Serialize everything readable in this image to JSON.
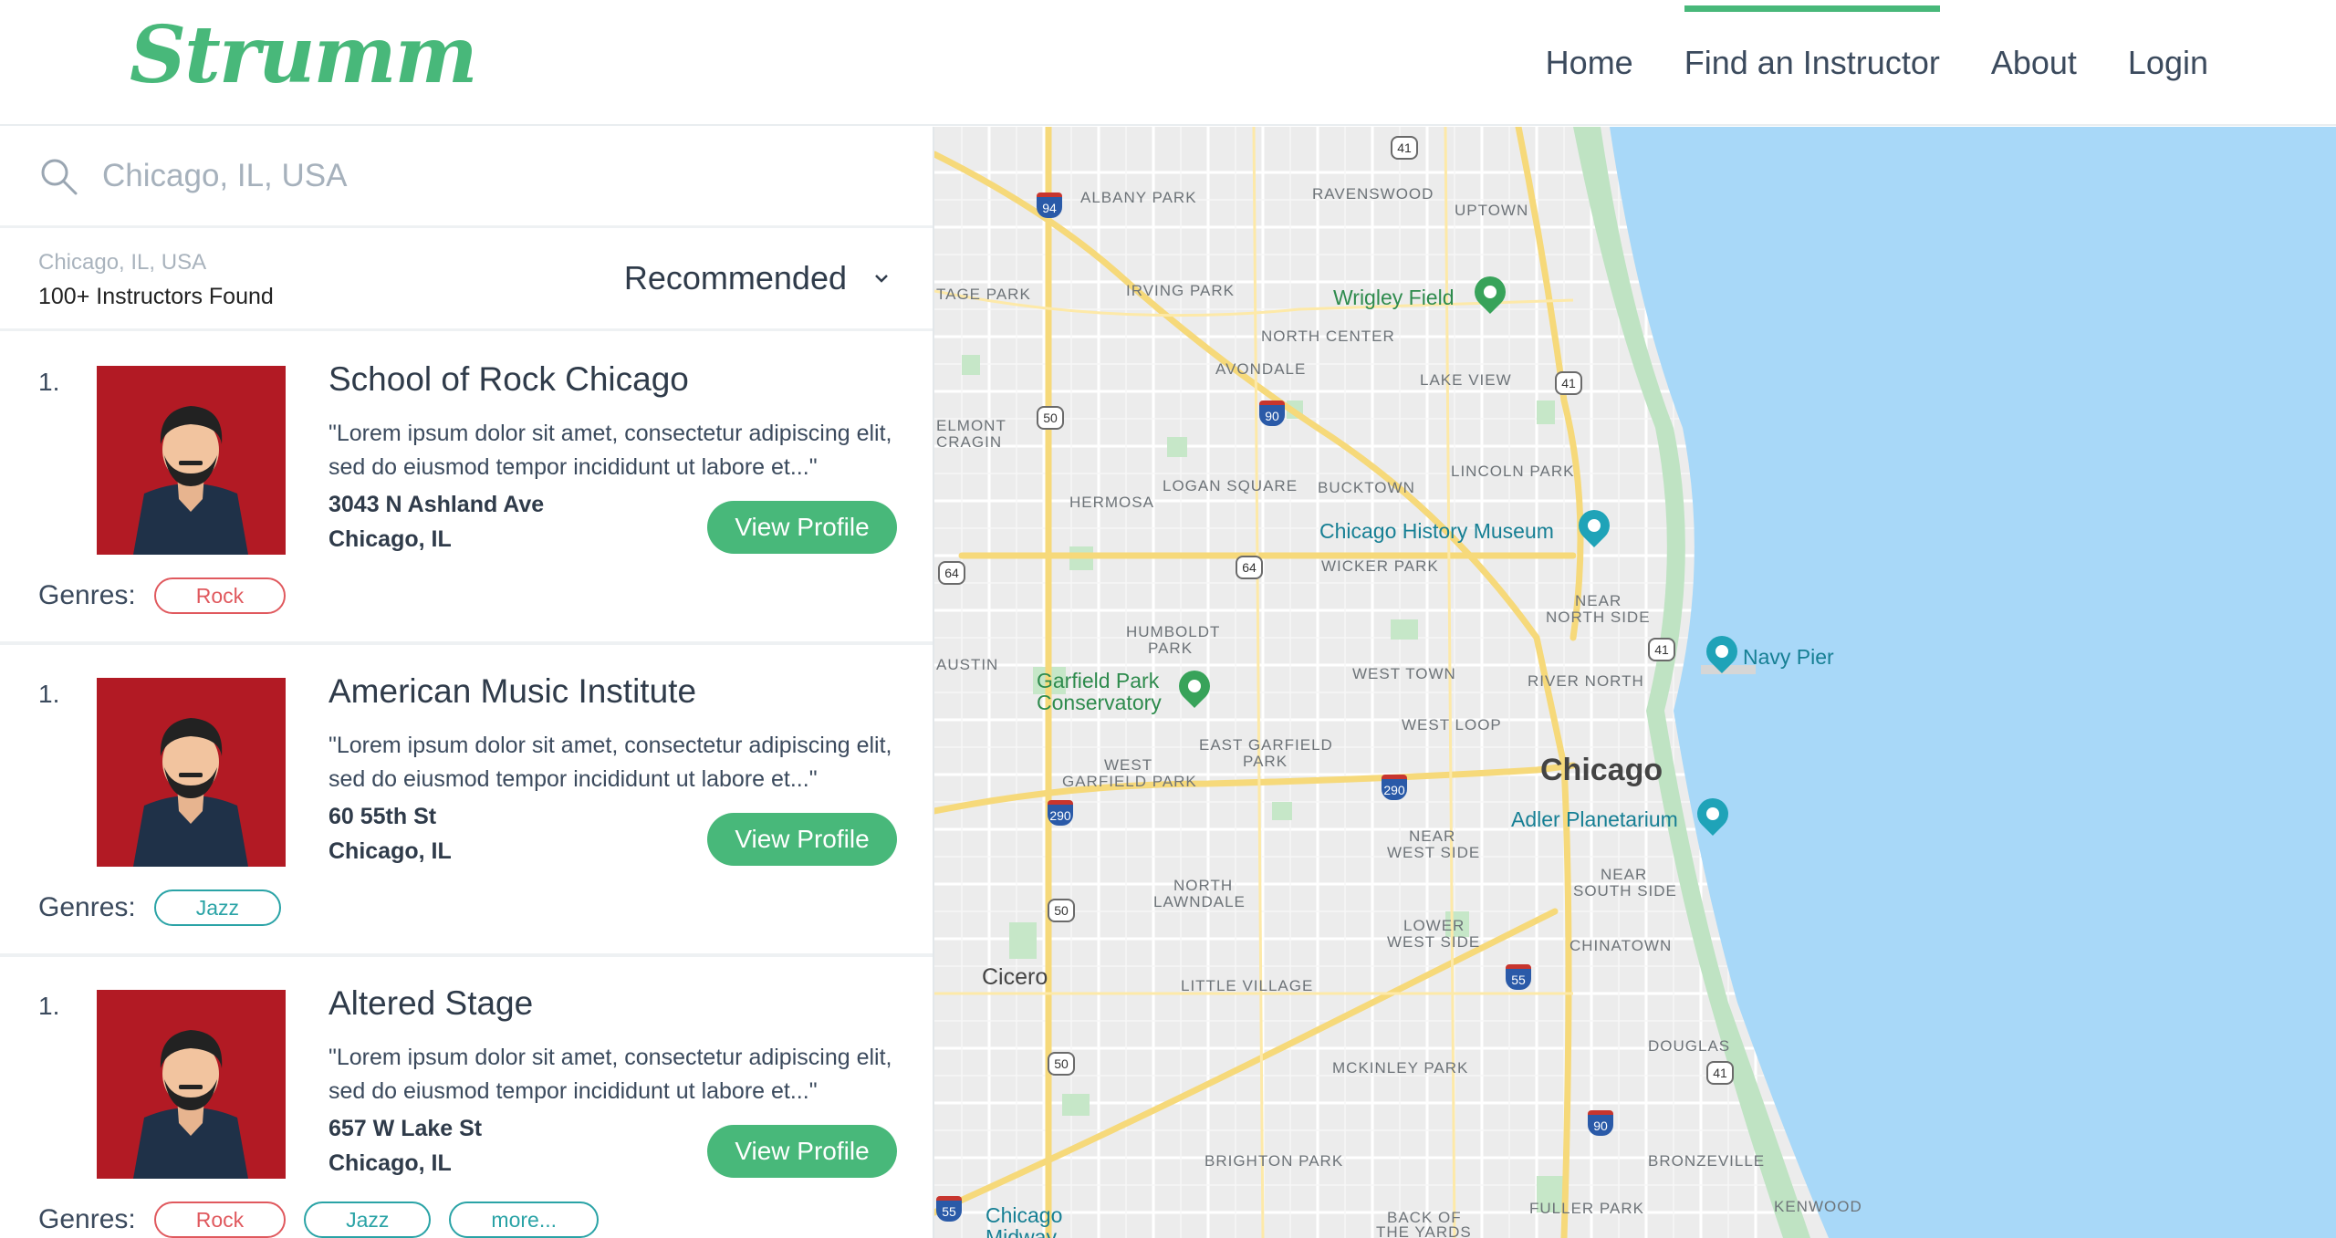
{
  "brand": {
    "logo": "Strumm",
    "accent": "#48b87a"
  },
  "nav": {
    "items": [
      {
        "label": "Home",
        "active": false
      },
      {
        "label": "Find an Instructor",
        "active": true
      },
      {
        "label": "About",
        "active": false
      },
      {
        "label": "Login",
        "active": false
      }
    ]
  },
  "search": {
    "placeholder": "Chicago, IL, USA",
    "value": ""
  },
  "results": {
    "location": "Chicago, IL, USA",
    "count_text": "100+ Instructors Found",
    "sort_label": "Recommended"
  },
  "instructors": [
    {
      "rank": "1.",
      "name": "School of Rock Chicago",
      "description": "\"Lorem ipsum dolor sit amet, consectetur adipiscing elit, sed do eiusmod tempor incididunt ut labore et...\"",
      "street": "3043 N Ashland Ave",
      "city": "Chicago, IL",
      "button": "View Profile",
      "genres_label": "Genres:",
      "genres": [
        "Rock"
      ]
    },
    {
      "rank": "1.",
      "name": "American Music Institute",
      "description": "\"Lorem ipsum dolor sit amet, consectetur adipiscing elit, sed do eiusmod tempor incididunt ut labore et...\"",
      "street": "60 55th St",
      "city": "Chicago, IL",
      "button": "View Profile",
      "genres_label": "Genres:",
      "genres": [
        "Jazz"
      ]
    },
    {
      "rank": "1.",
      "name": "Altered Stage",
      "description": "\"Lorem ipsum dolor sit amet, consectetur adipiscing elit, sed do eiusmod tempor incididunt ut labore et...\"",
      "street": "657 W Lake St",
      "city": "Chicago, IL",
      "button": "View Profile",
      "genres_label": "Genres:",
      "genres": [
        "Rock",
        "Jazz",
        "more..."
      ]
    }
  ],
  "map": {
    "city": "Chicago",
    "suburb": "Cicero",
    "neighborhoods": [
      "ALBANY PARK",
      "RAVENSWOOD",
      "UPTOWN",
      "TAGE PARK",
      "IRVING PARK",
      "NORTH CENTER",
      "AVONDALE",
      "LAKE VIEW",
      "ELMONT",
      "CRAGIN",
      "LOGAN SQUARE",
      "BUCKTOWN",
      "LINCOLN PARK",
      "HERMOSA",
      "WICKER PARK",
      "NEAR",
      "NORTH SIDE",
      "HUMBOLDT",
      "PARK",
      "AUSTIN",
      "WEST TOWN",
      "RIVER NORTH",
      "WEST LOOP",
      "EAST GARFIELD",
      "PARK",
      "WEST",
      "GARFIELD PARK",
      "NEAR",
      "WEST SIDE",
      "NEAR",
      "SOUTH SIDE",
      "NORTH",
      "LAWNDALE",
      "LOWER",
      "WEST SIDE",
      "CHINATOWN",
      "LITTLE VILLAGE",
      "MCKINLEY PARK",
      "DOUGLAS",
      "BRIGHTON PARK",
      "BRONZEVILLE",
      "FULLER PARK",
      "KENWOOD",
      "BACK OF",
      "THE YARDS"
    ],
    "pois": [
      {
        "name": "Wrigley Field",
        "kind": "stadium"
      },
      {
        "name": "Chicago History Museum",
        "kind": "museum"
      },
      {
        "name": "Navy Pier",
        "kind": "attraction"
      },
      {
        "name": "Garfield Park",
        "kind": "park"
      },
      {
        "name": "Conservatory",
        "kind": "park"
      },
      {
        "name": "Adler Planetarium",
        "kind": "attraction"
      },
      {
        "name": "Chicago",
        "kind": "place"
      },
      {
        "name": "Midway",
        "kind": "place"
      }
    ],
    "shields": [
      "41",
      "94",
      "90",
      "50",
      "64",
      "64",
      "41",
      "41",
      "50",
      "50",
      "55",
      "290",
      "290",
      "90",
      "41",
      "55"
    ],
    "colors": {
      "water": "#a8d8f8",
      "road": "#ffffff",
      "highway": "#f6d97a",
      "park": "#c3e6c4"
    }
  }
}
